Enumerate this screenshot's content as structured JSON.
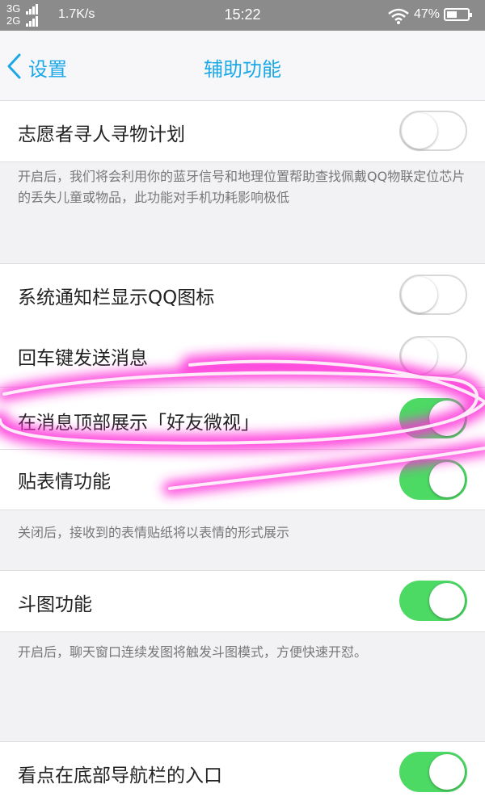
{
  "status_bar": {
    "network_top": "3G",
    "network_bottom": "2G",
    "speed": "1.7K/s",
    "time": "15:22",
    "battery": "47%",
    "icons": [
      "signal-icon",
      "wifi-icon",
      "battery-icon"
    ]
  },
  "nav": {
    "back_label": "设置",
    "title": "辅助功能"
  },
  "settings": [
    {
      "label": "志愿者寻人寻物计划",
      "on": false
    },
    {
      "label": "系统通知栏显示QQ图标",
      "on": false
    },
    {
      "label": "回车键发送消息",
      "on": false
    },
    {
      "label": "在消息顶部展示「好友微视」",
      "on": true
    },
    {
      "label": "贴表情功能",
      "on": true
    },
    {
      "label": "斗图功能",
      "on": true
    },
    {
      "label": "看点在底部导航栏的入口",
      "on": true
    }
  ],
  "descriptions": {
    "volunteer": "开启后，我们将会利用你的蓝牙信号和地理位置帮助查找佩戴QQ物联定位芯片的丢失儿童或物品，此功能对手机功耗影响极低",
    "sticker": "关闭后，接收到的表情贴纸将以表情的形式展示",
    "doutu": "开启后，聊天窗口连续发图将触发斗图模式，方便快速开怼。"
  },
  "colors": {
    "accent": "#1ba8e8",
    "toggle_on": "#4cd964",
    "highlight": "#ff2fd8"
  }
}
